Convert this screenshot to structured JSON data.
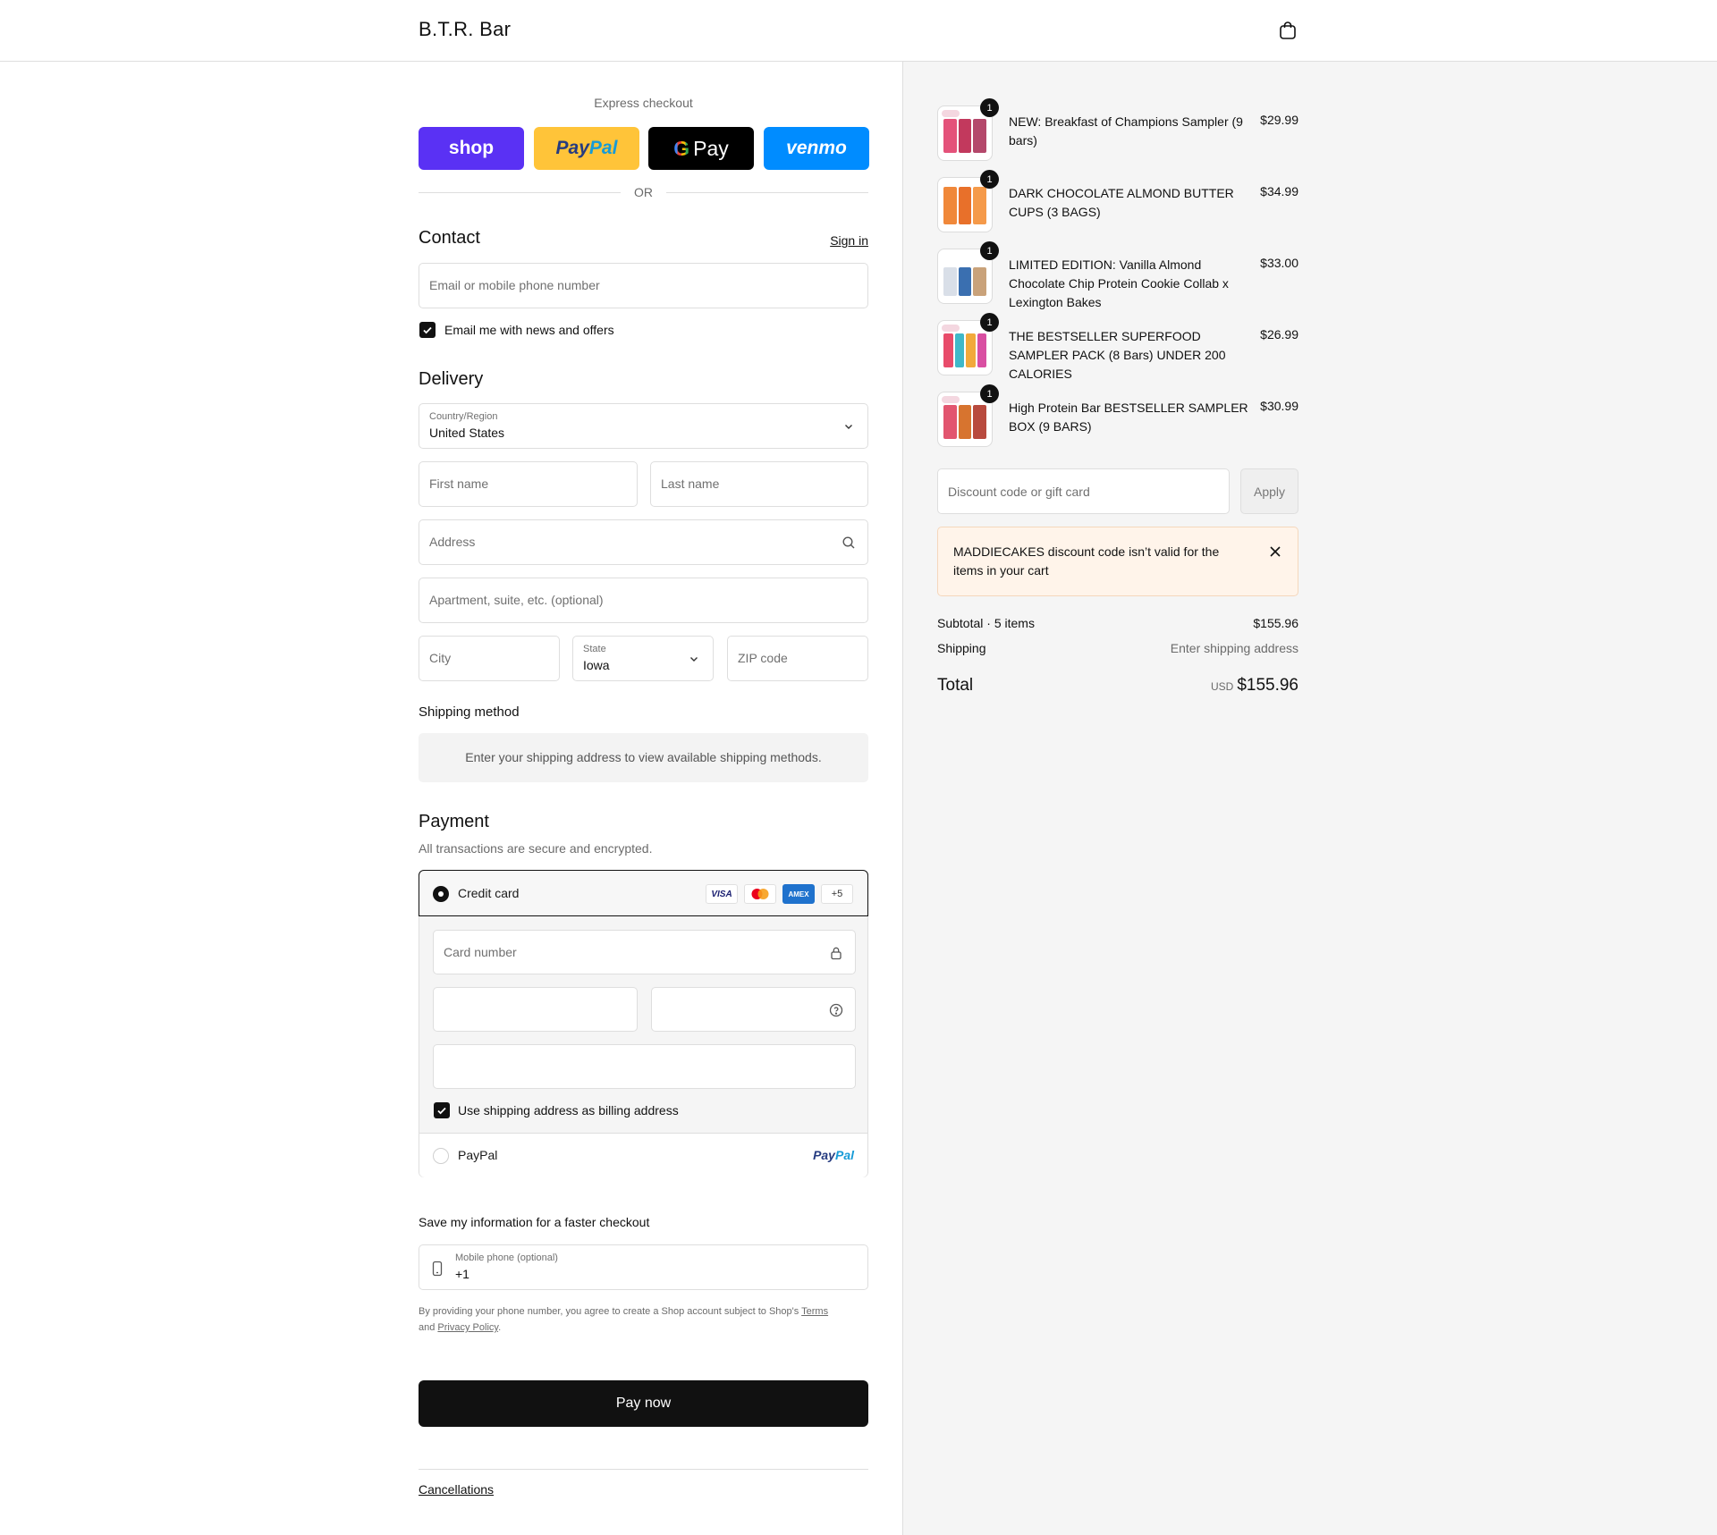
{
  "header": {
    "brand": "B.T.R. Bar"
  },
  "express": {
    "label": "Express checkout",
    "shop": "shop",
    "paypal_a": "Pay",
    "paypal_b": "Pal",
    "gpay_g": "G",
    "gpay": "Pay",
    "venmo": "venmo",
    "or": "OR"
  },
  "contact": {
    "title": "Contact",
    "sign_in": "Sign in",
    "email_placeholder": "Email or mobile phone number",
    "news_label": "Email me with news and offers"
  },
  "delivery": {
    "title": "Delivery",
    "country_label": "Country/Region",
    "country_value": "United States",
    "first_name": "First name",
    "last_name": "Last name",
    "address": "Address",
    "apartment": "Apartment, suite, etc. (optional)",
    "city": "City",
    "state_label": "State",
    "state_value": "Iowa",
    "zip": "ZIP code"
  },
  "shipping": {
    "title": "Shipping method",
    "note": "Enter your shipping address to view available shipping methods."
  },
  "payment": {
    "title": "Payment",
    "subtitle": "All transactions are secure and encrypted.",
    "credit_card": "Credit card",
    "cards": {
      "visa": "VISA",
      "amex": "AMEX",
      "more": "+5"
    },
    "card_number": "Card number",
    "billing_label": "Use shipping address as billing address",
    "paypal": "PayPal",
    "paypal_logo_a": "Pay",
    "paypal_logo_b": "Pal"
  },
  "save_info": {
    "title": "Save my information for a faster checkout",
    "phone_label": "Mobile phone (optional)",
    "phone_value": "+1",
    "legal_1": "By providing your phone number, you agree to create a Shop account subject to Shop's ",
    "terms": "Terms",
    "legal_2": "and ",
    "privacy": "Privacy Policy",
    "legal_3": "."
  },
  "pay_now": "Pay now",
  "footer": {
    "cancellations": "Cancellations"
  },
  "cart": {
    "items": [
      {
        "title": "NEW: Breakfast of Champions Sampler (9 bars)",
        "price": "$29.99",
        "qty": "1"
      },
      {
        "title": "DARK CHOCOLATE ALMOND BUTTER CUPS (3 BAGS)",
        "price": "$34.99",
        "qty": "1"
      },
      {
        "title": "LIMITED EDITION: Vanilla Almond Chocolate Chip Protein Cookie Collab x Lexington Bakes",
        "price": "$33.00",
        "qty": "1"
      },
      {
        "title": "THE BESTSELLER SUPERFOOD SAMPLER PACK (8 Bars) UNDER 200 CALORIES",
        "price": "$26.99",
        "qty": "1"
      },
      {
        "title": "High Protein Bar BESTSELLER SAMPLER BOX (9 BARS)",
        "price": "$30.99",
        "qty": "1"
      }
    ],
    "discount_placeholder": "Discount code or gift card",
    "apply": "Apply",
    "alert": "MADDIECAKES discount code isn’t valid for the items in your cart",
    "subtotal_label": "Subtotal · 5 items",
    "subtotal": "$155.96",
    "shipping_label": "Shipping",
    "shipping_value": "Enter shipping address",
    "total_label": "Total",
    "currency": "USD",
    "total": "$155.96"
  },
  "colors": {
    "shop": "#5a31f4",
    "paypal": "#ffc439",
    "venmo": "#008cff",
    "alert_bg": "#fff4ea",
    "button": "#111111"
  }
}
